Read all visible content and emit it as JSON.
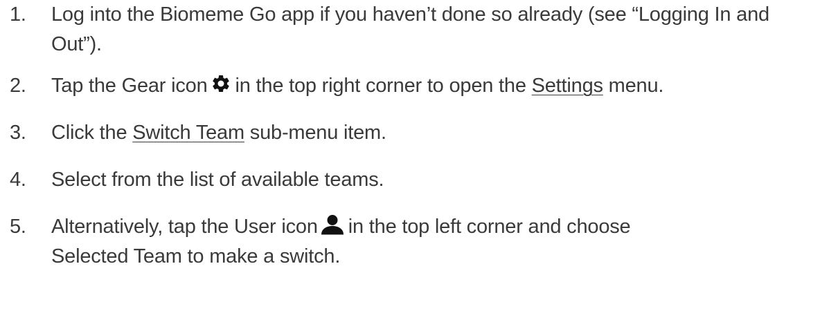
{
  "steps": [
    {
      "number": "1.",
      "text": "Log into the Biomeme Go app if you haven’t done so already (see “Logging In and Out”)."
    },
    {
      "number": "2.",
      "text_before_icon": "Tap the Gear icon",
      "icon": "gear-icon",
      "text_after_icon": "in the top right corner to open the",
      "link_text": "Settings",
      "text_end": "menu."
    },
    {
      "number": "3.",
      "text_before": "Click the",
      "link_text": "Switch Team",
      "text_after": "sub-menu item."
    },
    {
      "number": "4.",
      "text": "Select from the list of available teams."
    },
    {
      "number": "5.",
      "text_before_icon": "Alternatively, tap the User icon",
      "icon": "user-icon",
      "text_after_icon_line1": "in the top left corner and choose",
      "text_after_icon_line2": "Selected Team to make a switch."
    }
  ],
  "colors": {
    "text": "#3a3a3a",
    "icon": "#111111"
  }
}
